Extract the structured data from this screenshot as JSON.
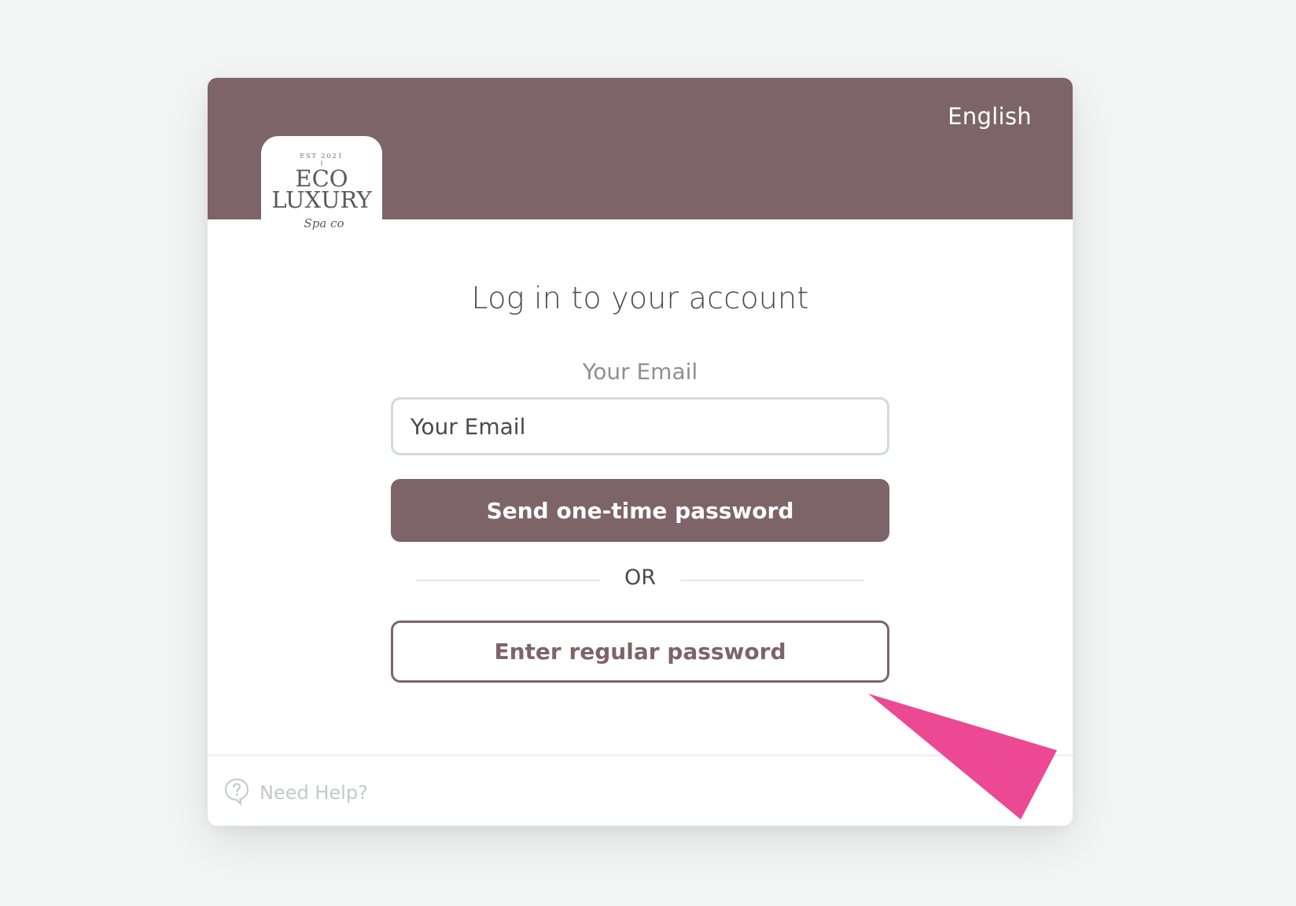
{
  "header": {
    "language": "English"
  },
  "logo": {
    "est": "EST 2021",
    "line1": "ECO",
    "line2": "LUXURY",
    "script": "Spa co"
  },
  "login": {
    "title": "Log in to your account",
    "email_label": "Your Email",
    "email_placeholder": "Your Email",
    "email_value": "",
    "send_otp_label": "Send one-time password",
    "or_label": "OR",
    "regular_password_label": "Enter regular password"
  },
  "footer": {
    "help_label": "Need Help?",
    "help_icon": "question-bubble-icon"
  },
  "annotation": {
    "icon": "pointer-arrow-icon",
    "color": "#ec4893"
  },
  "colors": {
    "brand": "#7d6468",
    "background": "#f4f5f5",
    "input_border": "#d3d9db"
  }
}
